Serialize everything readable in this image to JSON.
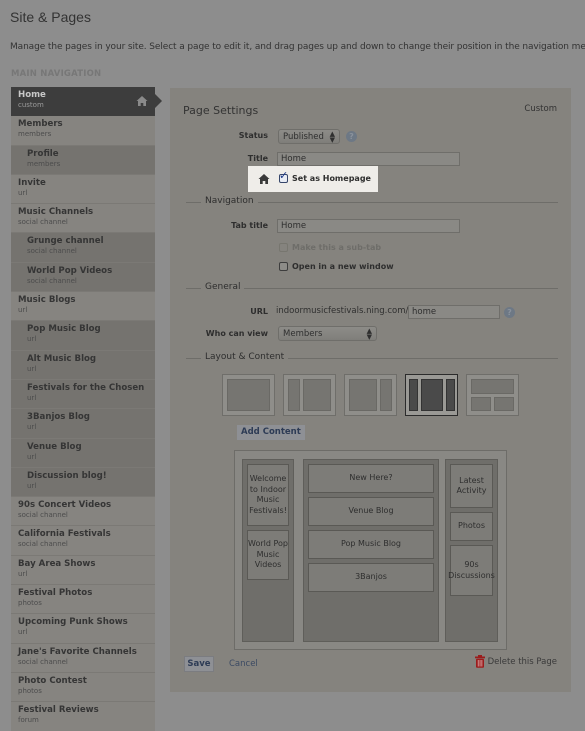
{
  "header": {
    "title": "Site & Pages",
    "intro": "Manage the pages in your site. Select a page to edit it, and drag pages up and down to change their position in the navigation menu.",
    "section_label": "MAIN NAVIGATION"
  },
  "sidebar": {
    "items": [
      {
        "title": "Home",
        "type": "custom",
        "sub": false,
        "active": true,
        "icon": "home-icon"
      },
      {
        "title": "Members",
        "type": "members",
        "sub": false
      },
      {
        "title": "Profile",
        "type": "members",
        "sub": true
      },
      {
        "title": "Invite",
        "type": "url",
        "sub": false
      },
      {
        "title": "Music Channels",
        "type": "social channel",
        "sub": false
      },
      {
        "title": "Grunge channel",
        "type": "social channel",
        "sub": true
      },
      {
        "title": "World Pop Videos",
        "type": "social channel",
        "sub": true
      },
      {
        "title": "Music Blogs",
        "type": "url",
        "sub": false
      },
      {
        "title": "Pop Music Blog",
        "type": "url",
        "sub": true
      },
      {
        "title": "Alt Music Blog",
        "type": "url",
        "sub": true
      },
      {
        "title": "Festivals for the Chosen",
        "type": "url",
        "sub": true
      },
      {
        "title": "3Banjos Blog",
        "type": "url",
        "sub": true
      },
      {
        "title": "Venue Blog",
        "type": "url",
        "sub": true
      },
      {
        "title": "Discussion blog!",
        "type": "url",
        "sub": true
      },
      {
        "title": "90s Concert Videos",
        "type": "social channel",
        "sub": false
      },
      {
        "title": "California Festivals",
        "type": "social channel",
        "sub": false
      },
      {
        "title": "Bay Area Shows",
        "type": "url",
        "sub": false
      },
      {
        "title": "Festival Photos",
        "type": "photos",
        "sub": false
      },
      {
        "title": "Upcoming Punk Shows",
        "type": "url",
        "sub": false
      },
      {
        "title": "Jane's Favorite Channels",
        "type": "social channel",
        "sub": false
      },
      {
        "title": "Photo Contest",
        "type": "photos",
        "sub": false
      },
      {
        "title": "Festival Reviews",
        "type": "forum",
        "sub": false
      }
    ]
  },
  "panel": {
    "title": "Page Settings",
    "page_type": "Custom",
    "status_label": "Status",
    "status_value": "Published",
    "title_label": "Title",
    "title_value": "Home",
    "homepage_label": "Set as Homepage",
    "homepage_checked": true,
    "navigation_legend": "Navigation",
    "tab_title_label": "Tab title",
    "tab_title_value": "Home",
    "subtab_label": "Make this a sub-tab",
    "subtab_checked": false,
    "new_window_label": "Open in a new window",
    "new_window_checked": false,
    "general_legend": "General",
    "url_label": "URL",
    "url_prefix": "indoormusicfestivals.ning.com/",
    "url_value": "home",
    "who_label": "Who can view",
    "who_value": "Members",
    "layout_legend": "Layout & Content",
    "layouts": [
      "one-column",
      "narrow-left-wide",
      "wide-narrow-right",
      "three-column",
      "header-two-column"
    ],
    "selected_layout": 3,
    "add_content_label": "Add Content",
    "columns": {
      "left": [
        "Welcome to Indoor Music Festivals!",
        "World Pop Music Videos"
      ],
      "center": [
        "New Here?",
        "Venue Blog",
        "Pop Music Blog",
        "3Banjos"
      ],
      "right": [
        "Latest Activity",
        "Photos",
        "90s Discussions"
      ]
    },
    "save_label": "Save",
    "cancel_label": "Cancel",
    "delete_label": "Delete this Page"
  },
  "colors": {
    "active_nav": "#3d3d3d",
    "delete_icon": "#9b1c1c",
    "link": "#3b4a63"
  }
}
